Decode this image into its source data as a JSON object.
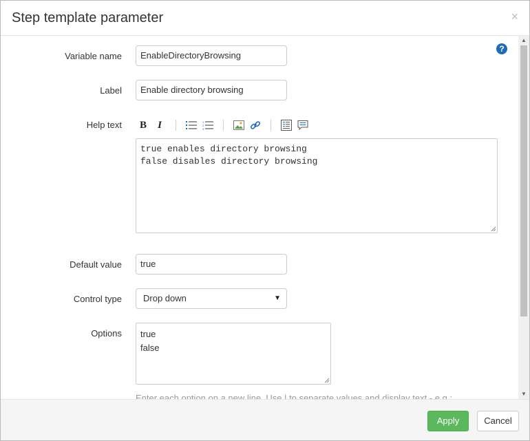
{
  "dialog": {
    "title": "Step template parameter",
    "close_glyph": "×"
  },
  "help": {
    "glyph": "?",
    "icon": "help-circle-icon",
    "color": "#1f6bb5"
  },
  "fields": {
    "variable_name": {
      "label": "Variable name",
      "value": "EnableDirectoryBrowsing"
    },
    "label": {
      "label": "Label",
      "value": "Enable directory browsing"
    },
    "help_text": {
      "label": "Help text",
      "lines": [
        "true enables directory browsing",
        "false disables directory browsing"
      ]
    },
    "default_value": {
      "label": "Default value",
      "value": "true"
    },
    "control_type": {
      "label": "Control type",
      "value": "Drop down",
      "caret": "▼"
    },
    "options": {
      "label": "Options",
      "lines": [
        "true",
        "false"
      ]
    }
  },
  "toolbar": {
    "bold": "B",
    "italic": "I",
    "icons": [
      "bold-icon",
      "italic-icon",
      "bulleted-list-icon",
      "numbered-list-icon",
      "image-icon",
      "link-icon",
      "preview-icon",
      "comment-icon"
    ]
  },
  "hint_text": "Enter each option on a new line. Use | to separate values and display text - e.g.:",
  "footer": {
    "apply_label": "Apply",
    "cancel_label": "Cancel"
  },
  "colors": {
    "apply_bg": "#5cb85c",
    "link_blue": "#1f6bb5"
  }
}
